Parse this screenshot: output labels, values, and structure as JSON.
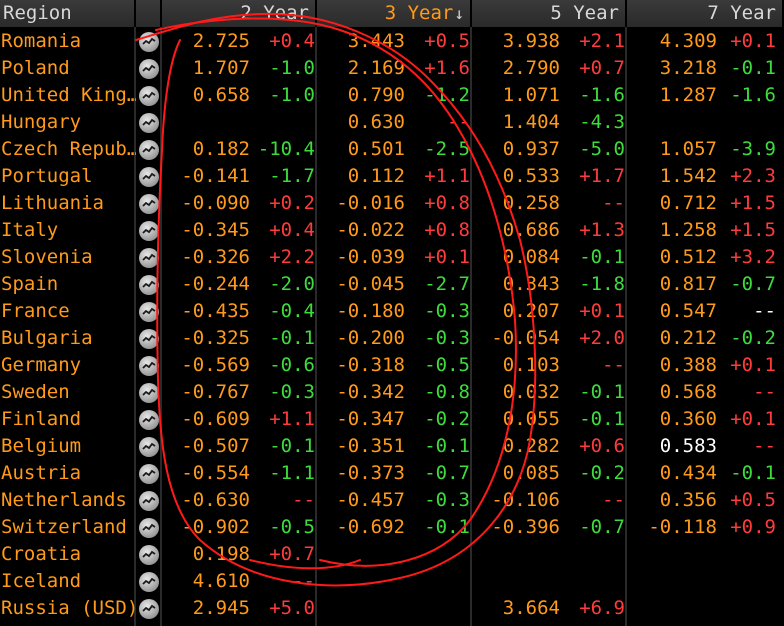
{
  "header": {
    "region": "Region",
    "y2": "2 Year",
    "y3": "3 Year",
    "y3_sort": "↓",
    "y5": "5 Year",
    "y7": "7 Year"
  },
  "rows": [
    {
      "region": "Romania",
      "v2": "2.725",
      "c2": "+0.4",
      "v3": "3.443",
      "c3": "+0.5",
      "v5": "3.938",
      "c5": "+2.1",
      "v7": "4.309",
      "c7": "+0.1"
    },
    {
      "region": "Poland",
      "v2": "1.707",
      "c2": "-1.0",
      "v3": "2.169",
      "c3": "+1.6",
      "v5": "2.790",
      "c5": "+0.7",
      "v7": "3.218",
      "c7": "-0.1"
    },
    {
      "region": "United King…",
      "v2": "0.658",
      "c2": "-1.0",
      "v3": "0.790",
      "c3": "-1.2",
      "v5": "1.071",
      "c5": "-1.6",
      "v7": "1.287",
      "c7": "-1.6"
    },
    {
      "region": "Hungary",
      "v2": "",
      "c2": "",
      "v3": "0.630",
      "c3": "--",
      "v5": "1.404",
      "c5": "-4.3",
      "v7": "",
      "c7": ""
    },
    {
      "region": "Czech Repub…",
      "v2": "0.182",
      "c2": "-10.4",
      "v3": "0.501",
      "c3": "-2.5",
      "v5": "0.937",
      "c5": "-5.0",
      "v7": "1.057",
      "c7": "-3.9"
    },
    {
      "region": "Portugal",
      "v2": "-0.141",
      "c2": "-1.7",
      "v3": "0.112",
      "c3": "+1.1",
      "v5": "0.533",
      "c5": "+1.7",
      "v7": "1.542",
      "c7": "+2.3"
    },
    {
      "region": "Lithuania",
      "v2": "-0.090",
      "c2": "+0.2",
      "v3": "-0.016",
      "c3": "+0.8",
      "v5": "0.258",
      "c5": "--",
      "v7": "0.712",
      "c7": "+1.5"
    },
    {
      "region": "Italy",
      "v2": "-0.345",
      "c2": "+0.4",
      "v3": "-0.022",
      "c3": "+0.8",
      "v5": "0.686",
      "c5": "+1.3",
      "v7": "1.258",
      "c7": "+1.5"
    },
    {
      "region": "Slovenia",
      "v2": "-0.326",
      "c2": "+2.2",
      "v3": "-0.039",
      "c3": "+0.1",
      "v5": "0.084",
      "c5": "-0.1",
      "v7": "0.512",
      "c7": "+3.2"
    },
    {
      "region": "Spain",
      "v2": "-0.244",
      "c2": "-2.0",
      "v3": "-0.045",
      "c3": "-2.7",
      "v5": "0.343",
      "c5": "-1.8",
      "v7": "0.817",
      "c7": "-0.7"
    },
    {
      "region": "France",
      "v2": "-0.435",
      "c2": "-0.4",
      "v3": "-0.180",
      "c3": "-0.3",
      "v5": "0.207",
      "c5": "+0.1",
      "v7": "0.547",
      "c7": "--"
    },
    {
      "region": "Bulgaria",
      "v2": "-0.325",
      "c2": "-0.1",
      "v3": "-0.200",
      "c3": "-0.3",
      "v5": "-0.054",
      "c5": "+2.0",
      "v7": "0.212",
      "c7": "-0.2"
    },
    {
      "region": "Germany",
      "v2": "-0.569",
      "c2": "-0.6",
      "v3": "-0.318",
      "c3": "-0.5",
      "v5": "0.103",
      "c5": "--",
      "v7": "0.388",
      "c7": "+0.1"
    },
    {
      "region": "Sweden",
      "v2": "-0.767",
      "c2": "-0.3",
      "v3": "-0.342",
      "c3": "-0.8",
      "v5": "0.032",
      "c5": "-0.1",
      "v7": "0.568",
      "c7": "--"
    },
    {
      "region": "Finland",
      "v2": "-0.609",
      "c2": "+1.1",
      "v3": "-0.347",
      "c3": "-0.2",
      "v5": "0.055",
      "c5": "-0.1",
      "v7": "0.360",
      "c7": "+0.1"
    },
    {
      "region": "Belgium",
      "v2": "-0.507",
      "c2": "-0.1",
      "v3": "-0.351",
      "c3": "-0.1",
      "v5": "0.282",
      "c5": "+0.6",
      "v7": "0.583",
      "c7": "--"
    },
    {
      "region": "Austria",
      "v2": "-0.554",
      "c2": "-1.1",
      "v3": "-0.373",
      "c3": "-0.7",
      "v5": "0.085",
      "c5": "-0.2",
      "v7": "0.434",
      "c7": "-0.1"
    },
    {
      "region": "Netherlands",
      "v2": "-0.630",
      "c2": "--",
      "v3": "-0.457",
      "c3": "-0.3",
      "v5": "-0.106",
      "c5": "--",
      "v7": "0.356",
      "c7": "+0.5"
    },
    {
      "region": "Switzerland",
      "v2": "-0.902",
      "c2": "-0.5",
      "v3": "-0.692",
      "c3": "-0.1",
      "v5": "-0.396",
      "c5": "-0.7",
      "v7": "-0.118",
      "c7": "+0.9"
    },
    {
      "region": "Croatia",
      "v2": "0.198",
      "c2": "+0.7",
      "v3": "",
      "c3": "",
      "v5": "",
      "c5": "",
      "v7": "",
      "c7": ""
    },
    {
      "region": "Iceland",
      "v2": "4.610",
      "c2": "--",
      "v3": "",
      "c3": "",
      "v5": "",
      "c5": "",
      "v7": "",
      "c7": ""
    },
    {
      "region": "Russia (USD)",
      "v2": "2.945",
      "c2": "+5.0",
      "v3": "",
      "c3": "",
      "v5": "3.664",
      "c5": "+6.9",
      "v7": "",
      "c7": ""
    }
  ],
  "colors": {
    "accent": "#ff9a1a",
    "up": "#ff3b3b",
    "down": "#3ddc3d",
    "annotation": "#ff1a1a"
  },
  "icons": {
    "row_spark": "sparkline-chart-icon",
    "sort": "sort-descending-icon"
  }
}
